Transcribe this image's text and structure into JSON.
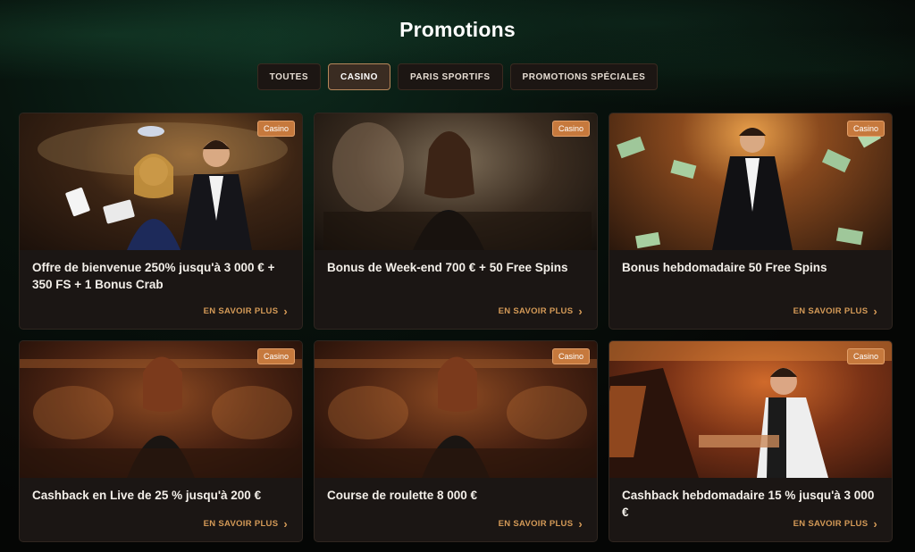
{
  "page": {
    "title": "Promotions"
  },
  "tabs": [
    {
      "label": "TOUTES",
      "active": false
    },
    {
      "label": "CASINO",
      "active": true
    },
    {
      "label": "PARIS SPORTIFS",
      "active": false
    },
    {
      "label": "PROMOTIONS SPÉCIALES",
      "active": false
    }
  ],
  "promotions": [
    {
      "badge": "Casino",
      "title": "Offre de bienvenue 250% jusqu'à 3 000 € + 350 FS + 1 Bonus Crab",
      "more": "EN SAVOIR PLUS"
    },
    {
      "badge": "Casino",
      "title": "Bonus de Week-end 700 € + 50 Free Spins",
      "more": "EN SAVOIR PLUS"
    },
    {
      "badge": "Casino",
      "title": "Bonus hebdomadaire 50 Free Spins",
      "more": "EN SAVOIR PLUS"
    },
    {
      "badge": "Casino",
      "title": "Cashback en Live de 25 % jusqu'à 200 €",
      "more": "EN SAVOIR PLUS"
    },
    {
      "badge": "Casino",
      "title": "Course de roulette 8 000 €",
      "more": "EN SAVOIR PLUS"
    },
    {
      "badge": "Casino",
      "title": "Cashback hebdomadaire 15 % jusqu'à 3 000 €",
      "more": "EN SAVOIR PLUS"
    }
  ],
  "colors": {
    "accent": "#d49a57",
    "badge": "#c6793d"
  }
}
